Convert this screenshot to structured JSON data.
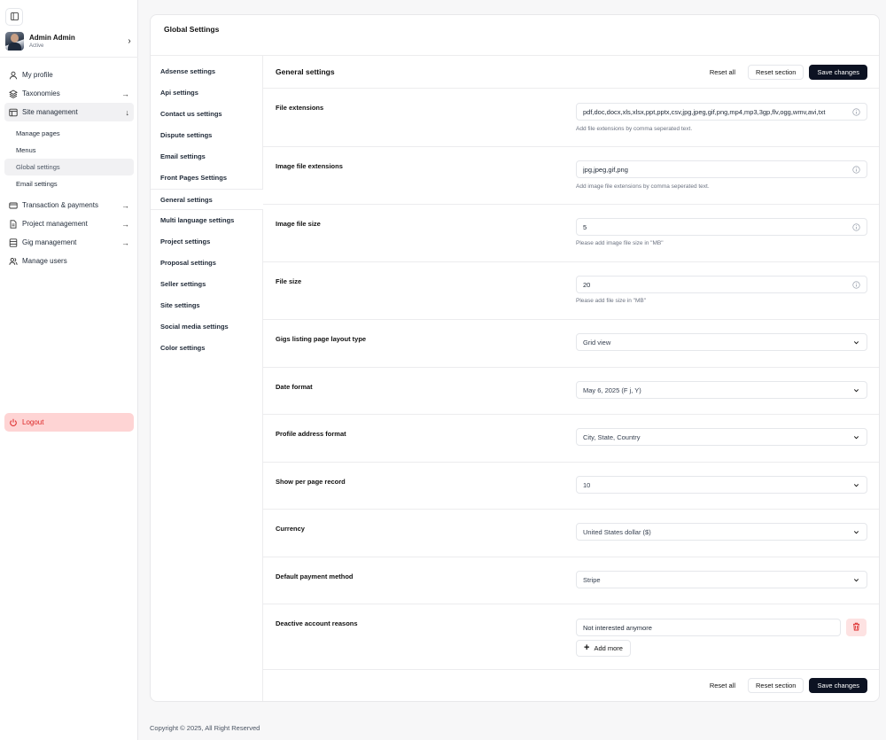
{
  "sidebar": {
    "user": {
      "name": "Admin Admin",
      "status": "Active"
    },
    "nav": [
      {
        "label": "My profile",
        "icon": "user-icon"
      },
      {
        "label": "Taxonomies",
        "icon": "layers-icon"
      },
      {
        "label": "Site management",
        "icon": "layout-icon"
      },
      {
        "label": "Transaction & payments",
        "icon": "credit-card-icon"
      },
      {
        "label": "Project management",
        "icon": "file-icon"
      },
      {
        "label": "Gig management",
        "icon": "database-icon"
      },
      {
        "label": "Manage users",
        "icon": "users-icon"
      }
    ],
    "site_management_sub": [
      "Manage pages",
      "Menus",
      "Global settings",
      "Email settings"
    ],
    "logout": "Logout"
  },
  "page": {
    "title": "Global Settings"
  },
  "tabs": [
    "Adsense settings",
    "Api settings",
    "Contact us settings",
    "Dispute settings",
    "Email settings",
    "Front Pages Settings",
    "General settings",
    "Multi language settings",
    "Project settings",
    "Proposal settings",
    "Seller settings",
    "Site settings",
    "Social media settings",
    "Color settings"
  ],
  "section": {
    "title": "General settings",
    "reset_all": "Reset all",
    "reset_section": "Reset section",
    "save": "Save changes"
  },
  "fields": {
    "file_extensions": {
      "label": "File extensions",
      "value": "pdf,doc,docx,xls,xlsx,ppt,pptx,csv,jpg,jpeg,gif,png,mp4,mp3,3gp,flv,ogg,wmv,avi,txt",
      "hint": "Add file extensions by comma seperated text."
    },
    "image_file_extensions": {
      "label": "Image file extensions",
      "value": "jpg,jpeg,gif,png",
      "hint": "Add image file extensions by comma seperated text."
    },
    "image_file_size": {
      "label": "Image file size",
      "value": "5",
      "hint": "Please add image file size in \"MB\""
    },
    "file_size": {
      "label": "File size",
      "value": "20",
      "hint": "Please add file size in \"MB\""
    },
    "gigs_layout": {
      "label": "Gigs listing page layout type",
      "value": "Grid view"
    },
    "date_format": {
      "label": "Date format",
      "value": "May 6, 2025 (F j, Y)"
    },
    "address_format": {
      "label": "Profile address format",
      "value": "City, State, Country"
    },
    "per_page": {
      "label": "Show per page record",
      "value": "10"
    },
    "currency": {
      "label": "Currency",
      "value": "United States dollar ($)"
    },
    "payment_method": {
      "label": "Default payment method",
      "value": "Stripe"
    },
    "deactive_reasons": {
      "label": "Deactive account reasons",
      "values": [
        "Not interested anymore"
      ],
      "add_more": "Add more"
    }
  },
  "footer": {
    "copyright": "Copyright © 2025, All Right Reserved"
  },
  "colors": {
    "primary": "#0c1222",
    "danger": "#dc2626",
    "danger_bg": "#fed4d4"
  }
}
